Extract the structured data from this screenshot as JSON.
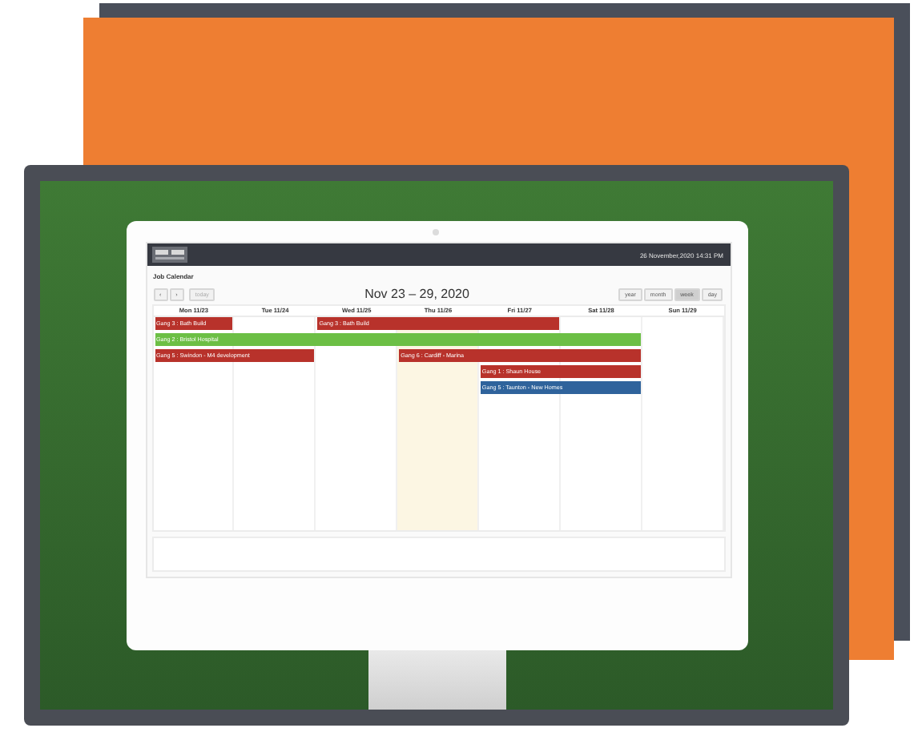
{
  "header": {
    "datetime": "26 November,2020 14:31 PM"
  },
  "page_title": "Job Calendar",
  "nav_buttons": [
    "‹",
    "›"
  ],
  "today_button": "today",
  "range_title": "Nov 23 – 29, 2020",
  "views": [
    {
      "label": "year",
      "selected": false
    },
    {
      "label": "month",
      "selected": false
    },
    {
      "label": "week",
      "selected": true
    },
    {
      "label": "day",
      "selected": false
    }
  ],
  "days": [
    {
      "label": "Mon 11/23",
      "today": false
    },
    {
      "label": "Tue 11/24",
      "today": false
    },
    {
      "label": "Wed 11/25",
      "today": false
    },
    {
      "label": "Thu 11/26",
      "today": true
    },
    {
      "label": "Fri 11/27",
      "today": false
    },
    {
      "label": "Sat 11/28",
      "today": false
    },
    {
      "label": "Sun 11/29",
      "today": false
    }
  ],
  "event_rows": [
    [
      {
        "kind": "start",
        "label": "Gang 3 : Bath Build",
        "color": "#b8322b"
      },
      {
        "kind": "empty"
      },
      {
        "kind": "start",
        "label": "Gang 3 : Bath Build",
        "color": "#b8322b"
      },
      {
        "kind": "continue"
      },
      {
        "kind": "continue"
      },
      {
        "kind": "empty"
      },
      {
        "kind": "empty"
      }
    ],
    [
      {
        "kind": "start",
        "label": "Gang 2 : Bristol Hospital",
        "color": "#6cbf45"
      },
      {
        "kind": "continue"
      },
      {
        "kind": "continue"
      },
      {
        "kind": "continue"
      },
      {
        "kind": "continue"
      },
      {
        "kind": "continue"
      },
      {
        "kind": "empty"
      }
    ],
    [
      {
        "kind": "start",
        "label": "Gang 5 : Swindon - M4 development",
        "color": "#b8322b"
      },
      {
        "kind": "continue"
      },
      {
        "kind": "empty"
      },
      {
        "kind": "start",
        "label": "Gang 6 : Cardiff - Marina",
        "color": "#b8322b"
      },
      {
        "kind": "continue"
      },
      {
        "kind": "continue"
      },
      {
        "kind": "empty"
      }
    ],
    [
      {
        "kind": "empty"
      },
      {
        "kind": "empty"
      },
      {
        "kind": "empty"
      },
      {
        "kind": "empty"
      },
      {
        "kind": "start",
        "label": "Gang 1 : Shaun House",
        "color": "#b8322b"
      },
      {
        "kind": "continue"
      },
      {
        "kind": "empty"
      }
    ],
    [
      {
        "kind": "empty"
      },
      {
        "kind": "empty"
      },
      {
        "kind": "empty"
      },
      {
        "kind": "empty"
      },
      {
        "kind": "start",
        "label": "Gang 5 : Taunton - New Homes",
        "color": "#2f639c"
      },
      {
        "kind": "continue"
      },
      {
        "kind": "empty"
      }
    ]
  ]
}
